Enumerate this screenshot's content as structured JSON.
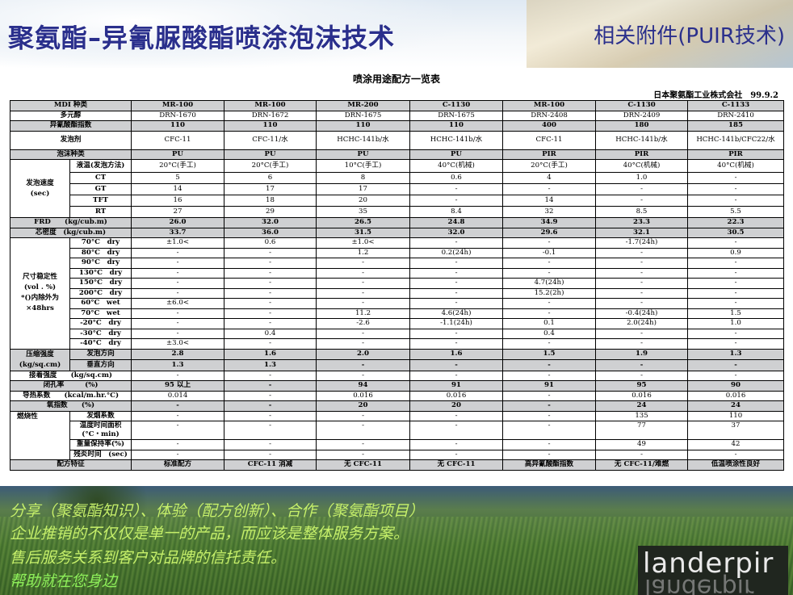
{
  "header": {
    "main_title": "聚氨酯–异氰脲酸酯喷涂泡沫技术",
    "sub_title": "相关附件(PUIR技术)"
  },
  "table_title": "喷涂用途配方一览表",
  "company": "日本聚氨酯工业株式会社　99.9.2",
  "table": {
    "mdi_label": "MDI 种类",
    "mdi": [
      "MR-100",
      "MR-100",
      "MR-200",
      "C-1130",
      "MR-100",
      "C-1130",
      "C-1133"
    ],
    "polyol_label": "多元醇",
    "polyol": [
      "DRN-1670",
      "DRN-1672",
      "DRN-1675",
      "DRN-1675",
      "DRN-2408",
      "DRN-2409",
      "DRN-2410"
    ],
    "index_label": "异氰酸酯指数",
    "index": [
      "110",
      "110",
      "110",
      "110",
      "400",
      "180",
      "185"
    ],
    "blowing_label": "发泡剂",
    "blowing": [
      "CFC-11",
      "CFC-11/水",
      "HCHC-141b/水",
      "HCHC-141b/水",
      "CFC-11",
      "HCHC-141b/水",
      "HCHC-141b/CFC22/水"
    ],
    "foam_type_label": "泡沫种类",
    "foam_type": [
      "PU",
      "PU",
      "PU",
      "PU",
      "PIR",
      "PIR",
      "PIR"
    ],
    "speed_section": "发泡速度\n(sec)",
    "liquid_temp_label": "液温(发泡方法)",
    "liquid_temp": [
      "20°C(手工)",
      "20°C(手工)",
      "10°C(手工)",
      "40°C(机械)",
      "20°C(手工)",
      "40°C(机械)",
      "40°C(机械)"
    ],
    "ct_label": "CT",
    "ct": [
      "5",
      "6",
      "8",
      "0.6",
      "4",
      "1.0",
      "-"
    ],
    "gt_label": "GT",
    "gt": [
      "14",
      "17",
      "17",
      "-",
      "-",
      "-",
      "-"
    ],
    "tft_label": "TFT",
    "tft": [
      "16",
      "18",
      "20",
      "-",
      "14",
      "-",
      "-"
    ],
    "rt_label": "RT",
    "rt": [
      "27",
      "29",
      "35",
      "8.4",
      "32",
      "8.5",
      "5.5"
    ],
    "frd_label": "FRD　　(kg/cub.m)",
    "frd": [
      "26.0",
      "32.0",
      "26.5",
      "24.8",
      "34.9",
      "23.3",
      "22.3"
    ],
    "core_label": "芯密度　(kg/cub.m)",
    "core": [
      "33.7",
      "36.0",
      "31.5",
      "32.0",
      "29.6",
      "32.1",
      "30.5"
    ],
    "dim_section": "尺寸稳定性\n(vol . %)\n*()内除外为\n×48hrs",
    "dim_rows": [
      {
        "label": "70°C　dry",
        "vals": [
          "±1.0<",
          "0.6",
          "±1.0<",
          "-",
          "-",
          "-1.7(24h)",
          "-"
        ]
      },
      {
        "label": "80°C　dry",
        "vals": [
          "-",
          "-",
          "1.2",
          "0.2(24h)",
          "-0.1",
          "-",
          "0.9"
        ]
      },
      {
        "label": "90°C　dry",
        "vals": [
          "-",
          "-",
          "-",
          "-",
          "-",
          "-",
          "-"
        ]
      },
      {
        "label": "130°C　dry",
        "vals": [
          "-",
          "-",
          "-",
          "-",
          "-",
          "-",
          "-"
        ]
      },
      {
        "label": "150°C　dry",
        "vals": [
          "-",
          "-",
          "-",
          "-",
          "4.7(24h)",
          "-",
          "-"
        ]
      },
      {
        "label": "200°C　dry",
        "vals": [
          "-",
          "-",
          "-",
          "-",
          "15.2(2h)",
          "-",
          "-"
        ]
      },
      {
        "label": "60°C　wet",
        "vals": [
          "±6.0<",
          "-",
          "-",
          "-",
          "-",
          "-",
          "-"
        ]
      },
      {
        "label": "70°C　wet",
        "vals": [
          "-",
          "-",
          "11.2",
          "4.6(24h)",
          "-",
          "-0.4(24h)",
          "1.5"
        ]
      },
      {
        "label": "-20°C　dry",
        "vals": [
          "-",
          "-",
          "-2.6",
          "-1.1(24h)",
          "0.1",
          "2.0(24h)",
          "1.0"
        ]
      },
      {
        "label": "-30°C　dry",
        "vals": [
          "-",
          "0.4",
          "-",
          "-",
          "0.4",
          "-",
          "-"
        ]
      },
      {
        "label": "-40°C　dry",
        "vals": [
          "±3.0<",
          "-",
          "-",
          "-",
          "-",
          "-",
          "-"
        ]
      }
    ],
    "comp_section": "压缩强度\n(kg/sq.cm)",
    "comp_rise_label": "发泡方向",
    "comp_rise": [
      "2.8",
      "1.6",
      "2.0",
      "1.6",
      "1.5",
      "1.9",
      "1.3"
    ],
    "comp_perp_label": "垂直方向",
    "comp_perp": [
      "1.3",
      "1.3",
      "-",
      "-",
      "-",
      "-",
      "-"
    ],
    "adhesion_label": "接着强度　　(kg/sq.cm)",
    "adhesion": [
      "-",
      "-",
      "-",
      "-",
      "-",
      "-",
      "-"
    ],
    "closed_label": "闭孔率　　　(%)",
    "closed": [
      "95 以上",
      "-",
      "94",
      "91",
      "91",
      "95",
      "90"
    ],
    "thermal_label": "导热系数　　(kcal/m.hr.°C)",
    "thermal": [
      "0.014",
      "-",
      "0.016",
      "0.016",
      "-",
      "0.016",
      "0.016"
    ],
    "oxygen_label": "氧指数　　(%)",
    "oxygen": [
      "-",
      "-",
      "20",
      "20",
      "-",
      "24",
      "24"
    ],
    "flame_section": "燃烧性",
    "smoke_label": "发烟系数",
    "smoke": [
      "-",
      "-",
      "-",
      "-",
      "-",
      "135",
      "110"
    ],
    "temp_area_label": "温度时间面积\n(°C・min)",
    "temp_area": [
      "-",
      "-",
      "-",
      "-",
      "-",
      "77",
      "37"
    ],
    "weight_label": "重量保持率(%)",
    "weight": [
      "-",
      "-",
      "-",
      "-",
      "-",
      "49",
      "42"
    ],
    "afterflame_label": "残炎时间　(sec)",
    "afterflame": [
      "-",
      "-",
      "-",
      "-",
      "-",
      "-",
      "-"
    ],
    "feature_label": "配方特征",
    "feature": [
      "标准配方",
      "CFC-11 消减",
      "无 CFC-11",
      "无 CFC-11",
      "高异氰酸酯指数",
      "无 CFC-11/难燃",
      "低温喷涂性良好"
    ]
  },
  "footer": {
    "line1": "分享（聚氨酯知识）、体验（配方创新）、合作（聚氨酯项目）",
    "line2": "企业推销的不仅仅是单一的产品，而应该是整体服务方案。",
    "line3": "售后服务关系到客户对品牌的信托责任。",
    "line4": "帮助就在您身边",
    "logo_text": "landerpir"
  }
}
